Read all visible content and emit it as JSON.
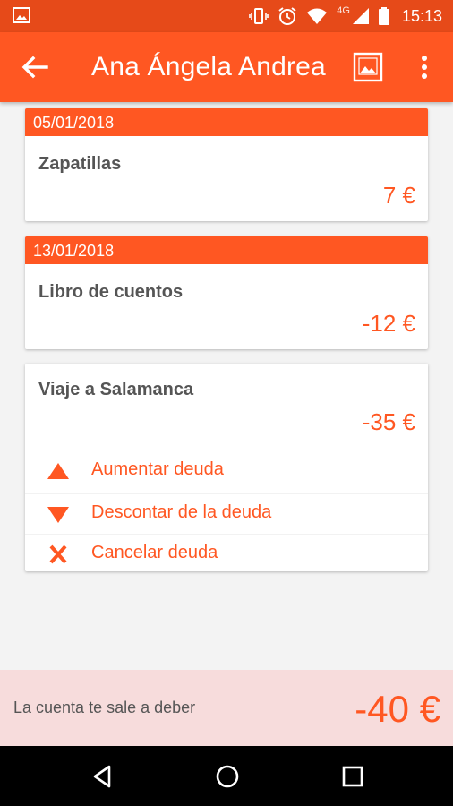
{
  "status_bar": {
    "time": "15:13",
    "network": "4G",
    "icons": [
      "image-icon",
      "vibrate-icon",
      "alarm-icon",
      "wifi-icon",
      "signal-icon",
      "battery-icon"
    ]
  },
  "app_bar": {
    "title": "Ana Ángela Andrea",
    "back_icon": "arrow-back-icon",
    "photo_icon": "image-icon",
    "menu_icon": "more-vert-icon"
  },
  "debts": [
    {
      "date": "05/01/2018",
      "concept": "Zapatillas",
      "amount": "7 €"
    },
    {
      "date": "13/01/2018",
      "concept": "Libro de cuentos",
      "amount": "-12 €"
    },
    {
      "date": "",
      "concept": "Viaje a Salamanca",
      "amount": "-35 €"
    }
  ],
  "actions": {
    "increase": "Aumentar deuda",
    "discount": "Descontar de la deuda",
    "cancel": "Cancelar deuda"
  },
  "footer": {
    "label": "La cuenta te sale a deber",
    "total": "-40 €"
  },
  "nav_bar": {
    "icons": [
      "back-icon",
      "home-icon",
      "recents-icon"
    ]
  },
  "colors": {
    "primary": "#ff5722",
    "primary_dark": "#e64a19",
    "footer_bg": "#f7dcdc"
  }
}
